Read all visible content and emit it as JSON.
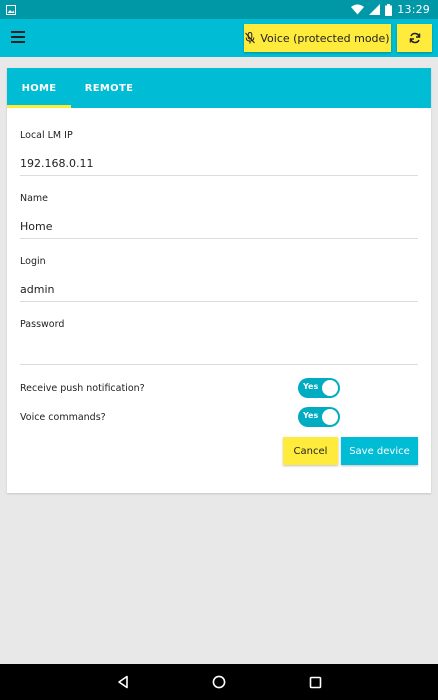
{
  "statusbar": {
    "time": "13:29"
  },
  "appbar": {
    "voice_label": "Voice (protected mode)"
  },
  "tabs": [
    {
      "label": "HOME",
      "active": true
    },
    {
      "label": "REMOTE",
      "active": false
    }
  ],
  "form": {
    "local_ip": {
      "label": "Local LM IP",
      "value": "192.168.0.11"
    },
    "name": {
      "label": "Name",
      "value": "Home"
    },
    "login": {
      "label": "Login",
      "value": "admin"
    },
    "password": {
      "label": "Password",
      "value": ""
    },
    "push": {
      "label": "Receive push notification?",
      "state": "Yes"
    },
    "voice": {
      "label": "Voice commands?",
      "state": "Yes"
    }
  },
  "buttons": {
    "cancel": "Cancel",
    "save": "Save device"
  },
  "colors": {
    "primary": "#00bcd4",
    "primary_dark": "#0097a7",
    "accent": "#ffeb3b"
  }
}
